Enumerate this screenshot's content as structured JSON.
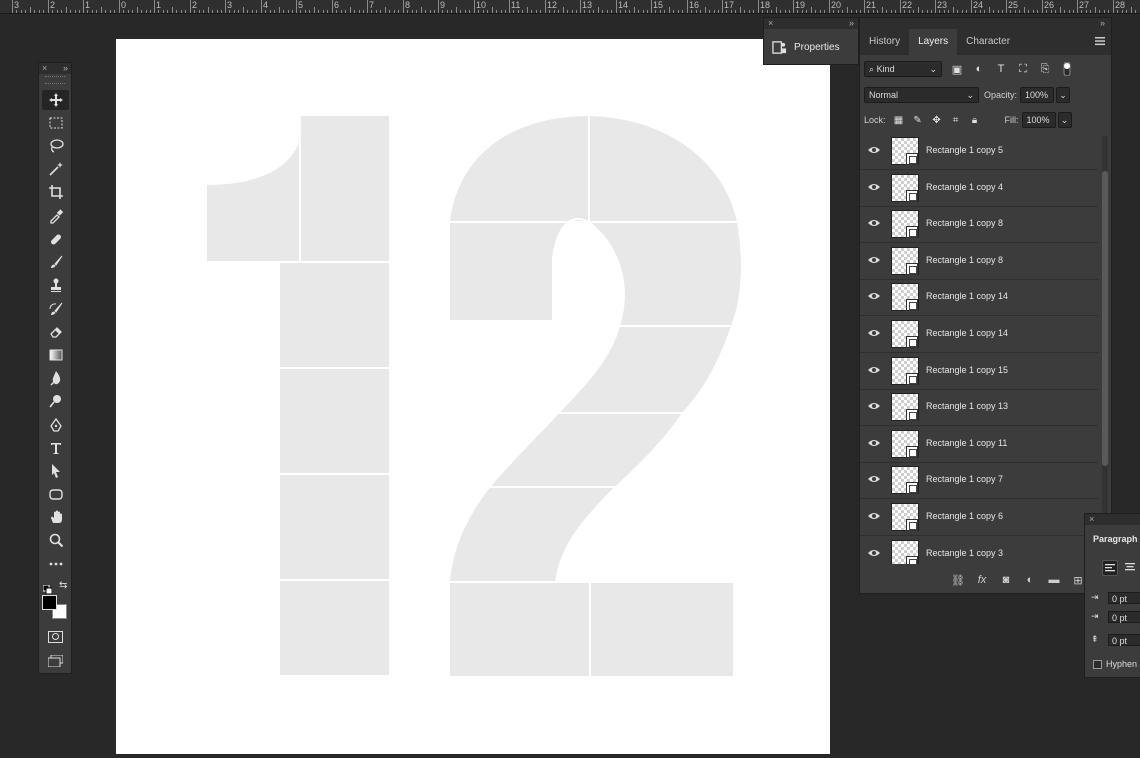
{
  "ruler": {
    "labels": [
      "3",
      "2",
      "1",
      "0",
      "1",
      "2",
      "3",
      "4",
      "5",
      "6",
      "7",
      "8",
      "9",
      "10",
      "11",
      "12",
      "13",
      "14",
      "15",
      "16",
      "17",
      "18",
      "19",
      "20",
      "21",
      "22",
      "23",
      "24",
      "25",
      "26",
      "27",
      "28"
    ]
  },
  "toolbar": {
    "collapse_glyph": "»",
    "close_glyph": "×",
    "tools": [
      "move-tool",
      "marquee-tool",
      "lasso-tool",
      "magic-wand-tool",
      "crop-tool",
      "eyedropper-tool",
      "healing-brush-tool",
      "brush-tool",
      "clone-stamp-tool",
      "history-brush-tool",
      "eraser-tool",
      "gradient-tool",
      "blur-tool",
      "dodge-tool",
      "pen-tool",
      "type-tool",
      "path-selection-tool",
      "shape-tool",
      "hand-tool",
      "zoom-tool",
      "more-tools"
    ],
    "active_tool": "move-tool",
    "foreground_color": "#000000",
    "background_color": "#ffffff"
  },
  "properties": {
    "label": "Properties",
    "close_glyph": "×",
    "collapse_glyph": "»"
  },
  "layers_panel": {
    "tabs": [
      {
        "label": "History",
        "active": false
      },
      {
        "label": "Layers",
        "active": true
      },
      {
        "label": "Character",
        "active": false
      }
    ],
    "filter_kind": "Kind",
    "blend_mode": "Normal",
    "opacity_label": "Opacity:",
    "opacity_value": "100%",
    "lock_label": "Lock:",
    "fill_label": "Fill:",
    "fill_value": "100%",
    "layers": [
      "Rectangle 1 copy 5",
      "Rectangle 1 copy 4",
      "Rectangle 1 copy 8",
      "Rectangle 1 copy 8",
      "Rectangle 1 copy 14",
      "Rectangle 1 copy 14",
      "Rectangle 1 copy 15",
      "Rectangle 1 copy 13",
      "Rectangle 1 copy 11",
      "Rectangle 1 copy 7",
      "Rectangle 1 copy 6",
      "Rectangle 1 copy 3"
    ],
    "footer_icons": [
      "link-icon",
      "fx-icon",
      "mask-icon",
      "adjustment-icon",
      "folder-icon",
      "new-layer-icon",
      "trash-icon"
    ],
    "footer_fx": "fx"
  },
  "paragraph_panel": {
    "title": "Paragraph",
    "indent_values": [
      "0 pt",
      "0 pt",
      "0 pt"
    ],
    "hyphenate_label": "Hyphen"
  },
  "canvas": {
    "background": "#ffffff",
    "shape_fill": "#e8e8e8"
  }
}
